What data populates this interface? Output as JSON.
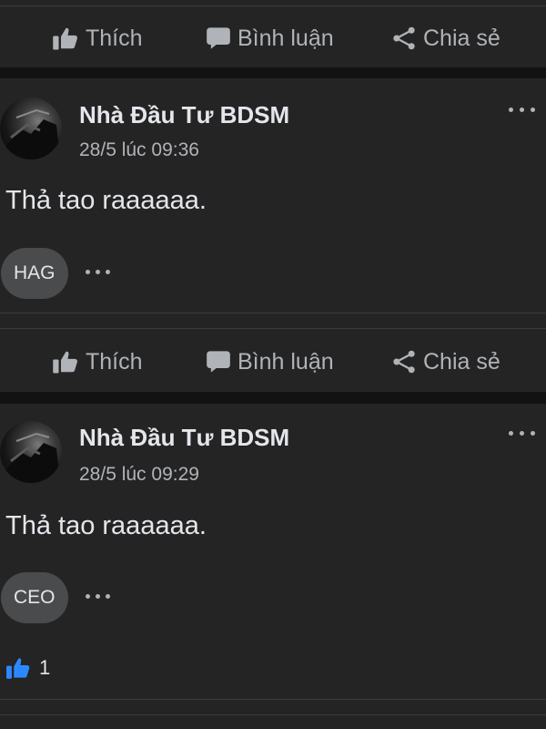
{
  "actions": {
    "like_label": "Thích",
    "comment_label": "Bình luận",
    "share_label": "Chia sẻ"
  },
  "posts": [
    {
      "author": "Nhà Đầu Tư BDSM",
      "timestamp": "28/5 lúc 09:36",
      "text": "Thả tao raaaaaa.",
      "tag": "HAG"
    },
    {
      "author": "Nhà Đầu Tư BDSM",
      "timestamp": "28/5 lúc 09:29",
      "text": "Thả tao raaaaaa.",
      "tag": "CEO",
      "like_count": "1"
    }
  ],
  "colors": {
    "background": "#242424",
    "separator": "#121212",
    "secondary_text": "#b0b3b8",
    "like_blue": "#2d88ff"
  },
  "icons": [
    "like-icon",
    "comment-icon",
    "share-icon",
    "more-icon"
  ]
}
